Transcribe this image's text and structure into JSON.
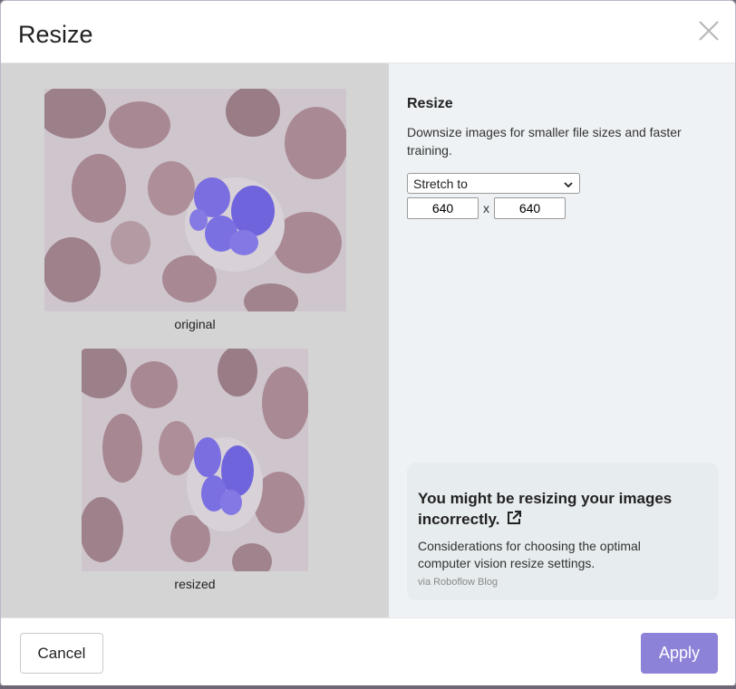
{
  "dialog": {
    "title": "Resize",
    "close_icon": "close-icon"
  },
  "preview": {
    "original_caption": "original",
    "resized_caption": "resized"
  },
  "settings": {
    "heading": "Resize",
    "description": "Downsize images for smaller file sizes and faster training.",
    "mode_selected": "Stretch to",
    "width_value": "640",
    "separator": "x",
    "height_value": "640"
  },
  "tip_card": {
    "title": "You might be resizing your images incorrectly.",
    "link_icon": "external-link-icon",
    "description": "Considerations for choosing the optimal computer vision resize settings.",
    "source": "via Roboflow Blog"
  },
  "footer": {
    "cancel_label": "Cancel",
    "apply_label": "Apply"
  },
  "colors": {
    "accent": "#8c82d8",
    "left_panel": "#d4d4d4",
    "right_panel": "#eef2f4"
  }
}
